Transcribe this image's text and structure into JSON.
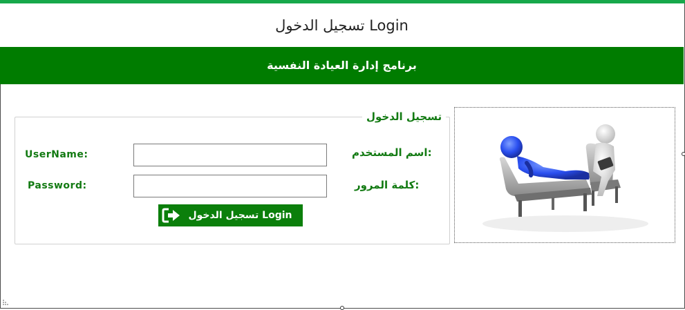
{
  "window": {
    "title": "تسجيل الدخول Login"
  },
  "banner": {
    "text": "برنامج إدارة العيادة النفسية"
  },
  "form": {
    "legend": "تسجيل الدخول",
    "username": {
      "label_en": "UserName:",
      "label_ar": "اسم المستخدم:",
      "value": "",
      "placeholder": ""
    },
    "password": {
      "label_en": "Password:",
      "label_ar": "كلمة المرور:",
      "value": "",
      "placeholder": ""
    },
    "login_button": {
      "label": "تسجيل الدخول Login",
      "icon": "sign-in-icon"
    }
  },
  "image": {
    "icon": "therapy-session-illustration"
  },
  "colors": {
    "accent_green": "#007c00",
    "top_strip": "#17a84b",
    "label_green": "#127a12"
  }
}
